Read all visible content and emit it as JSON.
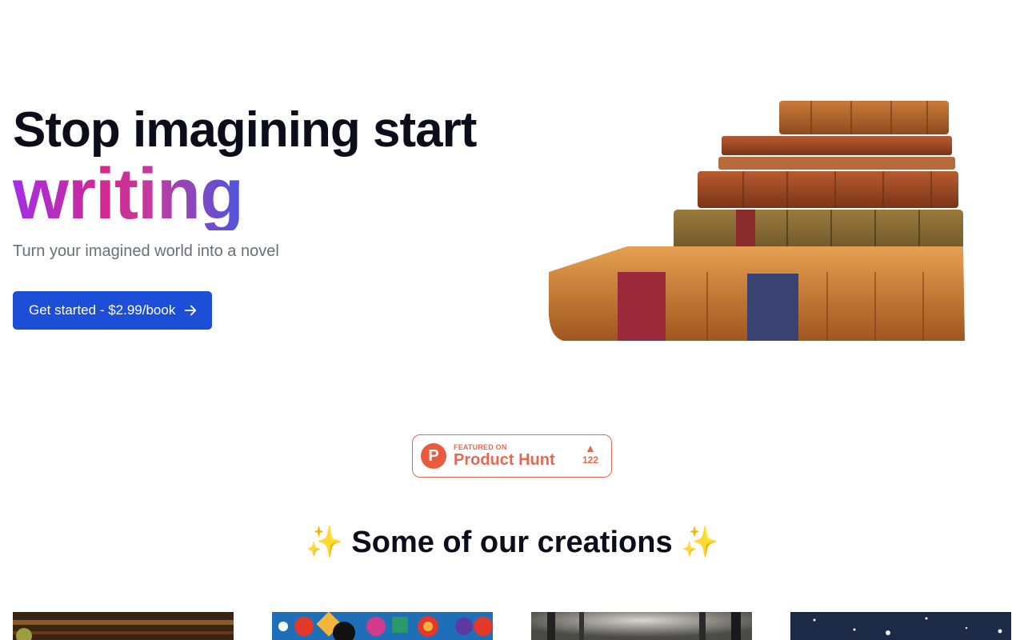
{
  "hero": {
    "headline_line1": "Stop imagining start",
    "headline_line2": "writing",
    "subheadline": "Turn your imagined world into a novel",
    "cta_label": "Get started - $2.99/book",
    "image_alt": "Stack of antique leather-bound books"
  },
  "product_hunt": {
    "featured_on": "FEATURED ON",
    "name": "Product Hunt",
    "logo_letter": "P",
    "votes": "122",
    "upvote_symbol": "▲"
  },
  "creations": {
    "sparkle_left": "✨",
    "title": "Some of our creations",
    "sparkle_right": "✨",
    "cards": [
      {
        "name": "book-cover-1"
      },
      {
        "name": "book-cover-2"
      },
      {
        "name": "book-cover-3"
      },
      {
        "name": "book-cover-4"
      }
    ]
  },
  "colors": {
    "primary": "#1d4ed8",
    "product_hunt": "#e06a55",
    "gradient": [
      "#a32ee6",
      "#d2298f",
      "#4a55e0"
    ]
  }
}
